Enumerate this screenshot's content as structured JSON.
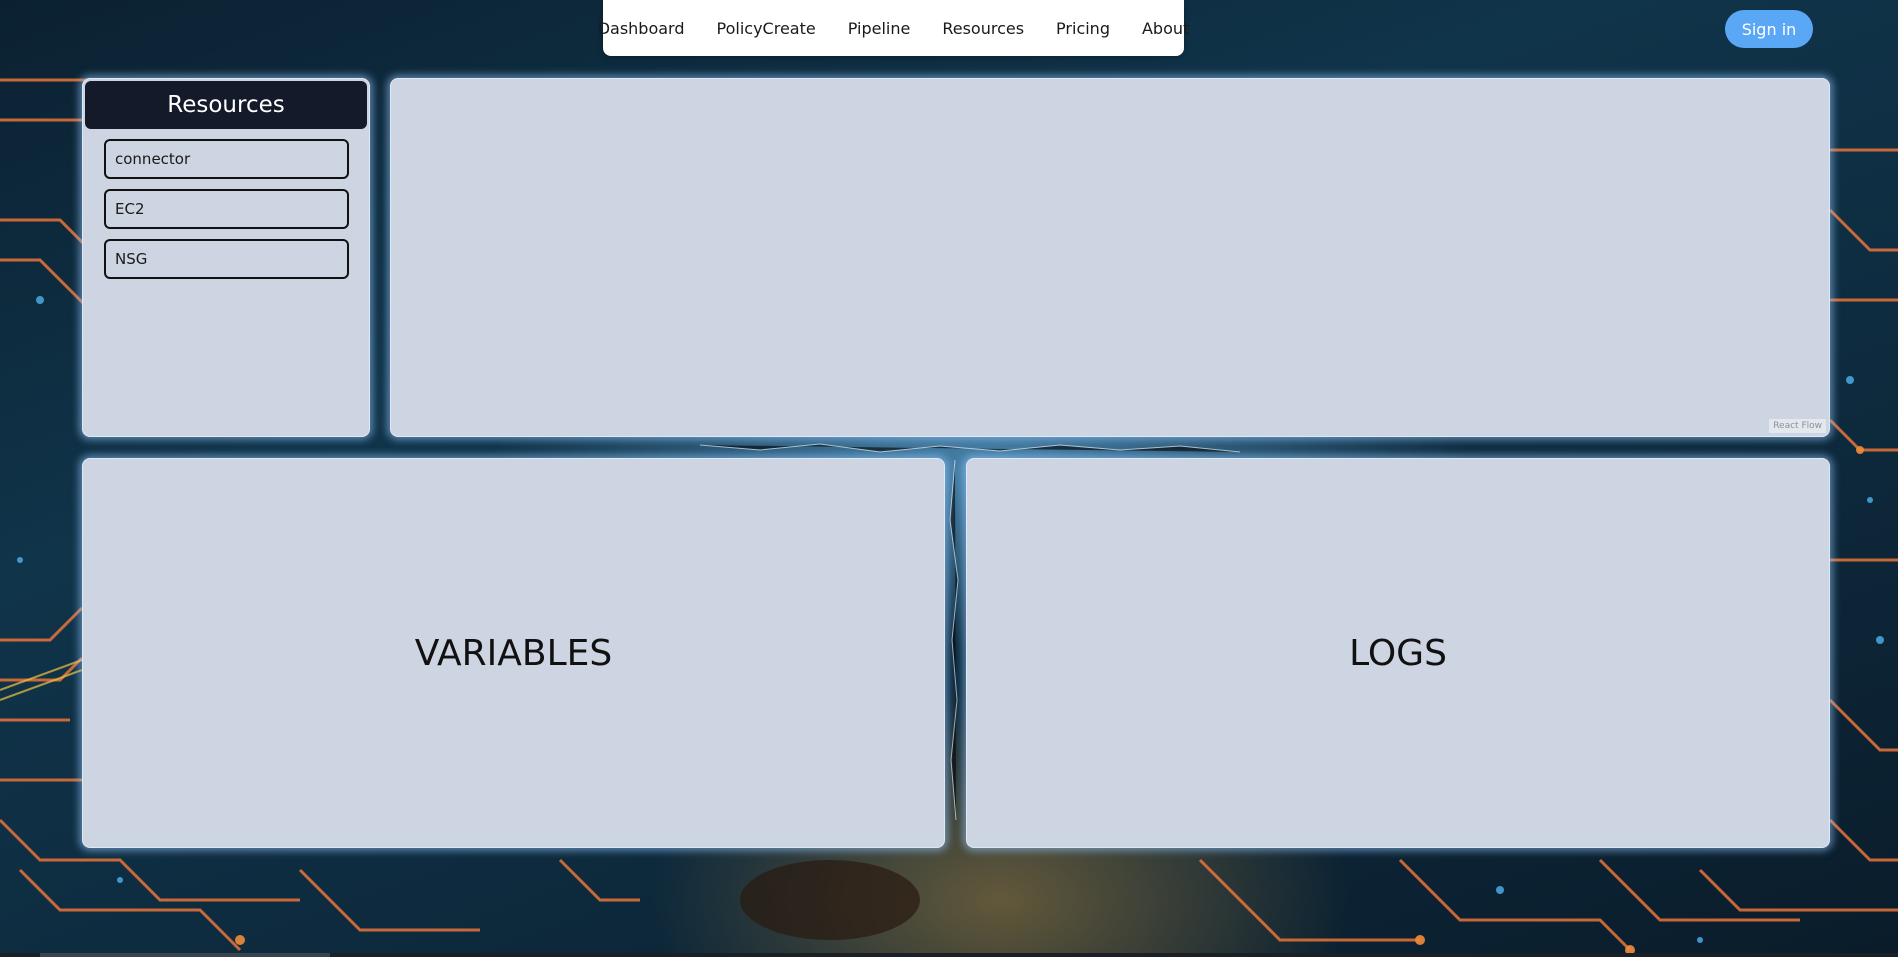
{
  "nav": {
    "items": [
      {
        "label": "Dashboard"
      },
      {
        "label": "PolicyCreate"
      },
      {
        "label": "Pipeline"
      },
      {
        "label": "Resources"
      },
      {
        "label": "Pricing"
      },
      {
        "label": "About"
      }
    ],
    "signin_label": "Sign in"
  },
  "resources_panel": {
    "title": "Resources",
    "items": [
      {
        "label": "connector"
      },
      {
        "label": "EC2"
      },
      {
        "label": "NSG"
      }
    ]
  },
  "flow_canvas": {
    "attribution": "React Flow"
  },
  "variables_panel": {
    "title": "VARIABLES"
  },
  "logs_panel": {
    "title": "LOGS"
  },
  "colors": {
    "accent": "#5aa8f5",
    "panel": "#cdd5e2",
    "header": "#141a29"
  }
}
